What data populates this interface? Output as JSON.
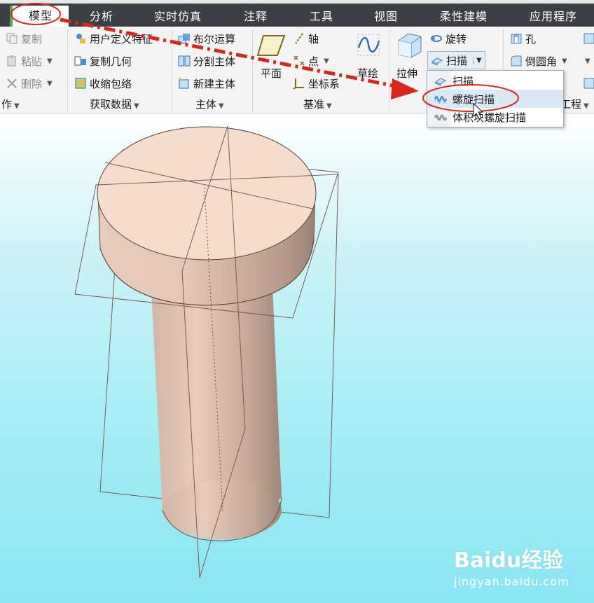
{
  "tabs": [
    {
      "label": "模型",
      "active": true
    },
    {
      "label": "分析"
    },
    {
      "label": "实时仿真"
    },
    {
      "label": "注释"
    },
    {
      "label": "工具"
    },
    {
      "label": "视图"
    },
    {
      "label": "柔性建模"
    },
    {
      "label": "应用程序"
    }
  ],
  "ribbon": {
    "operations": {
      "copy": "复制",
      "paste": "粘贴",
      "delete": "删除",
      "group_label": "作"
    },
    "get_data": {
      "udf": "用户定义特征",
      "copy_geometry": "复制几何",
      "shrinkwrap": "收缩包络",
      "group_label": "获取数据"
    },
    "body": {
      "boolean": "布尔运算",
      "split": "分割主体",
      "new_body": "新建主体",
      "group_label": "主体"
    },
    "datum": {
      "plane": "平面",
      "axis": "轴",
      "point": "点",
      "csys": "坐标系",
      "sketch": "草绘",
      "group_label": "基准"
    },
    "shapes": {
      "extrude": "拉伸",
      "revolve": "旋转",
      "sweep": "扫描"
    },
    "engineering": {
      "hole": "孔",
      "round": "倒圆角",
      "group_label": "工程"
    }
  },
  "sweep_menu": {
    "items": [
      "扫描",
      "螺旋扫描",
      "体积块螺旋扫描"
    ],
    "highlighted_index": 1
  },
  "watermark": {
    "logo": "Baidu经验",
    "url": "jingyan.baidu.com"
  },
  "colors": {
    "annotation_red": "#d9261c",
    "tab_bar": "#3c3f44",
    "highlight": "#dbe9f7",
    "model_face": "#f3d6c6",
    "viewport_bottom": "#8ae5f2"
  }
}
